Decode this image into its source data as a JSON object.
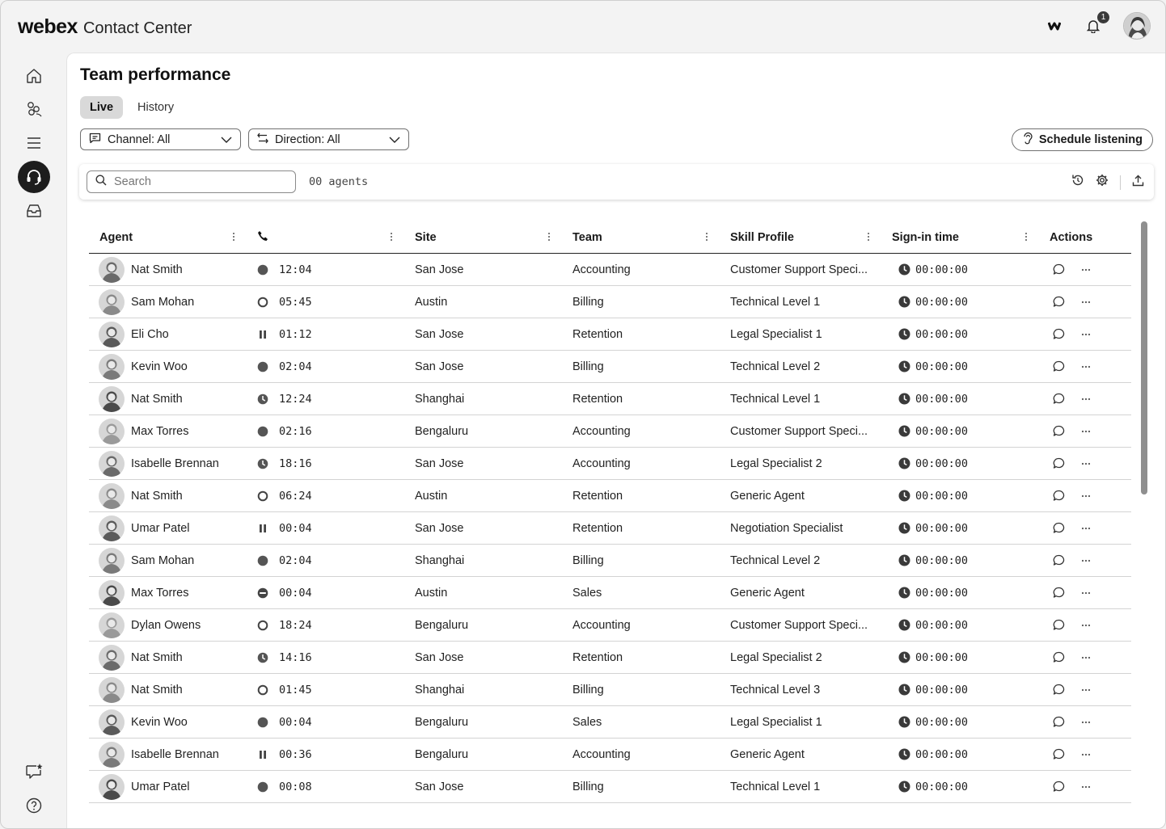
{
  "brand": {
    "logo": "webex",
    "product": "Contact Center"
  },
  "header": {
    "notification_count": "1"
  },
  "page": {
    "title": "Team performance",
    "tabs": [
      {
        "label": "Live"
      },
      {
        "label": "History"
      }
    ],
    "filters": {
      "channel": "Channel: All",
      "direction": "Direction: All"
    },
    "schedule_button": "Schedule listening",
    "search": {
      "placeholder": "Search"
    },
    "agent_count": "00 agents"
  },
  "table": {
    "columns": [
      "Agent",
      "",
      "Site",
      "Team",
      "Skill Profile",
      "Sign-in time",
      "Actions"
    ],
    "rows": [
      {
        "agent": "Nat Smith",
        "state": "busy",
        "time": "12:04",
        "site": "San Jose",
        "team": "Accounting",
        "skill": "Customer Support Speci...",
        "signin": "00:00:00"
      },
      {
        "agent": "Sam Mohan",
        "state": "idle",
        "time": "05:45",
        "site": "Austin",
        "team": "Billing",
        "skill": "Technical Level 1",
        "signin": "00:00:00"
      },
      {
        "agent": "Eli Cho",
        "state": "hold",
        "time": "01:12",
        "site": "San Jose",
        "team": "Retention",
        "skill": "Legal Specialist 1",
        "signin": "00:00:00"
      },
      {
        "agent": "Kevin Woo",
        "state": "busy",
        "time": "02:04",
        "site": "San Jose",
        "team": "Billing",
        "skill": "Technical Level 2",
        "signin": "00:00:00"
      },
      {
        "agent": "Nat Smith",
        "state": "wrapup",
        "time": "12:24",
        "site": "Shanghai",
        "team": "Retention",
        "skill": "Technical Level 1",
        "signin": "00:00:00"
      },
      {
        "agent": "Max Torres",
        "state": "busy",
        "time": "02:16",
        "site": "Bengaluru",
        "team": "Accounting",
        "skill": "Customer Support Speci...",
        "signin": "00:00:00"
      },
      {
        "agent": "Isabelle Brennan",
        "state": "wrapup",
        "time": "18:16",
        "site": "San Jose",
        "team": "Accounting",
        "skill": "Legal Specialist 2",
        "signin": "00:00:00"
      },
      {
        "agent": "Nat Smith",
        "state": "idle",
        "time": "06:24",
        "site": "Austin",
        "team": "Retention",
        "skill": "Generic Agent",
        "signin": "00:00:00"
      },
      {
        "agent": "Umar Patel",
        "state": "hold",
        "time": "00:04",
        "site": "San Jose",
        "team": "Retention",
        "skill": "Negotiation Specialist",
        "signin": "00:00:00"
      },
      {
        "agent": "Sam Mohan",
        "state": "busy",
        "time": "02:04",
        "site": "Shanghai",
        "team": "Billing",
        "skill": "Technical Level 2",
        "signin": "00:00:00"
      },
      {
        "agent": "Max Torres",
        "state": "dnd",
        "time": "00:04",
        "site": "Austin",
        "team": "Sales",
        "skill": "Generic Agent",
        "signin": "00:00:00"
      },
      {
        "agent": "Dylan Owens",
        "state": "idle",
        "time": "18:24",
        "site": "Bengaluru",
        "team": "Accounting",
        "skill": "Customer Support Speci...",
        "signin": "00:00:00"
      },
      {
        "agent": "Nat Smith",
        "state": "wrapup",
        "time": "14:16",
        "site": "San Jose",
        "team": "Retention",
        "skill": "Legal Specialist 2",
        "signin": "00:00:00"
      },
      {
        "agent": "Nat Smith",
        "state": "idle",
        "time": "01:45",
        "site": "Shanghai",
        "team": "Billing",
        "skill": "Technical Level 3",
        "signin": "00:00:00"
      },
      {
        "agent": "Kevin Woo",
        "state": "busy",
        "time": "00:04",
        "site": "Bengaluru",
        "team": "Sales",
        "skill": "Legal Specialist 1",
        "signin": "00:00:00"
      },
      {
        "agent": "Isabelle Brennan",
        "state": "hold",
        "time": "00:36",
        "site": "Bengaluru",
        "team": "Accounting",
        "skill": "Generic Agent",
        "signin": "00:00:00"
      },
      {
        "agent": "Umar Patel",
        "state": "busy",
        "time": "00:08",
        "site": "San Jose",
        "team": "Billing",
        "skill": "Technical Level 1",
        "signin": "00:00:00"
      }
    ]
  },
  "icons": {
    "sidebar": [
      "home-icon",
      "team-icon",
      "menu-icon",
      "headset-icon",
      "inbox-icon",
      "feedback-icon",
      "help-icon"
    ],
    "header": [
      "webex-icon",
      "bell-icon",
      "avatar"
    ]
  }
}
